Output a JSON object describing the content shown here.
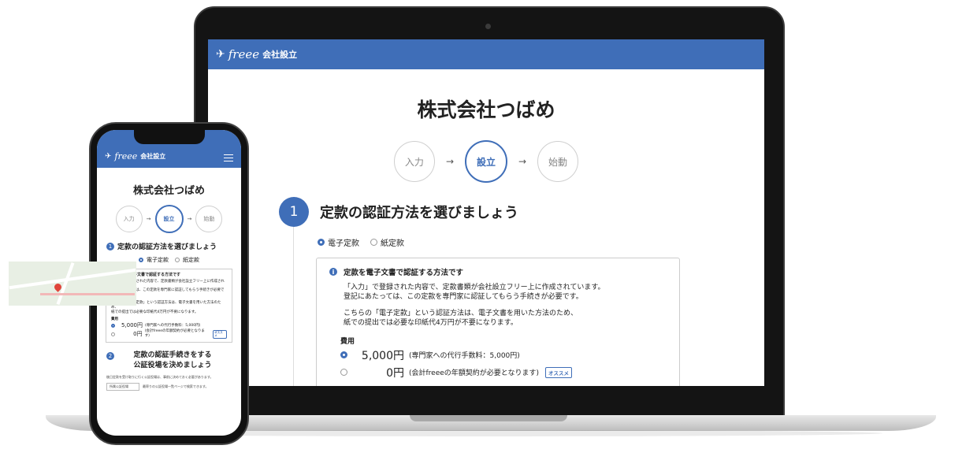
{
  "brand": {
    "logo_icon": "✈",
    "name": "freee",
    "service": "会社設立",
    "accent": "#3f6eb8"
  },
  "page": {
    "title": "株式会社つばめ",
    "steps": [
      "入力",
      "設立",
      "始動"
    ],
    "active_step": "設立"
  },
  "section1": {
    "number": "1",
    "title": "定款の認証方法を選びましょう",
    "options": [
      "電子定款",
      "紙定款"
    ],
    "selected": "電子定款",
    "info_title": "定款を電子文書で認証する方法です",
    "info_p1_l1": "「入力」で登録された内容で、定款書類が会社設立フリー上に作成されています。",
    "info_p1_l2": "登記にあたっては、この定款を専門家に認証してもらう手続きが必要です。",
    "info_p2_l1": "こちらの「電子定款」という認証方法は、電子文書を用いた方法のため、",
    "info_p2_l2": "紙での提出では必要な印紙代4万円が不要になります。",
    "fee_label": "費用",
    "fee_options": [
      {
        "amount": "5,000円",
        "note": "(専門家への代行手数料：5,000円)"
      },
      {
        "amount": "0円",
        "note": "(会計freeeの年額契約が必要となります)",
        "badge": "オススメ"
      }
    ]
  },
  "phone": {
    "section2_number": "2",
    "section2_title_l1": "定款の認証手続きをする",
    "section2_title_l2": "公証役場を決めましょう",
    "section2_text": "後日定款を受け取りに行く公証役場は、事前に決めておく必要があります。",
    "select_value": "所属公証役場",
    "select_note": "最寄りの公証役場一覧ページで検索できます。"
  }
}
